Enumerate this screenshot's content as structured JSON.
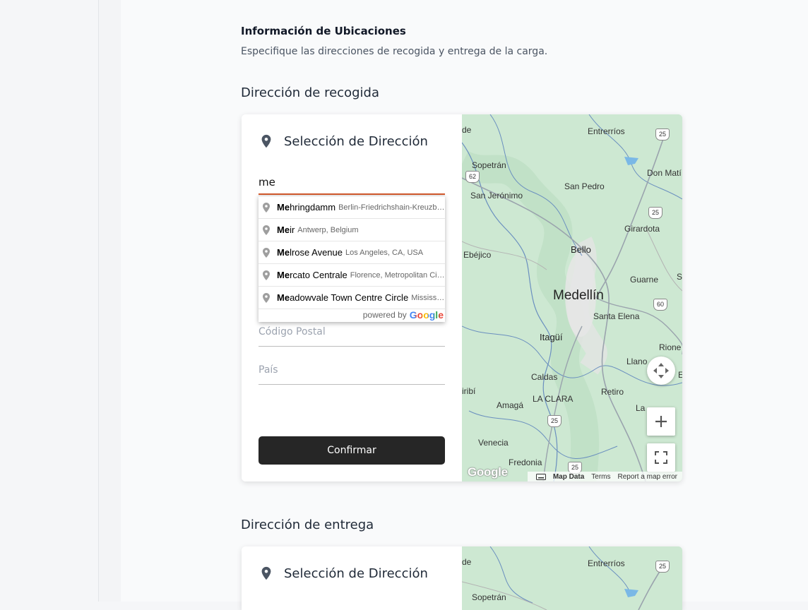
{
  "section": {
    "title": "Información de Ubicaciones",
    "subtitle": "Especifique las direcciones de recogida y entrega de la carga."
  },
  "pickup": {
    "heading": "Dirección de recogida",
    "card_title": "Selección de Dirección",
    "input_value": "me",
    "postal_placeholder": "Código Postal",
    "country_placeholder": "País",
    "confirm_label": "Confirmar"
  },
  "autocomplete": {
    "items": [
      {
        "match": "Me",
        "rest": "hringdamm",
        "secondary": "Berlin-Friedrichshain-Kreuzberg, Berlin, Germany"
      },
      {
        "match": "Me",
        "rest": "ir",
        "secondary": "Antwerp, Belgium"
      },
      {
        "match": "Me",
        "rest": "lrose Avenue",
        "secondary": "Los Angeles, CA, USA"
      },
      {
        "match": "Me",
        "rest": "rcato Centrale",
        "secondary": "Florence, Metropolitan City of Florence, Italy"
      },
      {
        "match": "Me",
        "rest": "adowvale Town Centre Circle",
        "secondary": "Mississauga, ON, Canada"
      }
    ],
    "powered_by": "powered by",
    "brand": "Google"
  },
  "map": {
    "labels": {
      "entrerrios": "Entrerríos",
      "sopetran": "Sopetrán",
      "don_matias": "Don Matí",
      "san_jeronimo": "San Jerónimo",
      "san_pedro": "San Pedro",
      "girardota": "Girardota",
      "ebejico": "Ebéjico",
      "bello": "Bello",
      "guarne": "Guarne",
      "medellin": "Medellín",
      "santa_elena": "Santa Elena",
      "itagui": "Itagüí",
      "rionegro": "Rione",
      "caldas": "Caldas",
      "llano": "Llano",
      "retiro": "Retiro",
      "amaga": "Amagá",
      "la_clara": "LA CLARA",
      "la_ceja": "La",
      "venecia": "Venecia",
      "fredonia": "Fredonia",
      "s_edge": "S",
      "iribi": "iribí",
      "e_edge": "E",
      "de_edge": "de"
    },
    "shields": {
      "r25a": "25",
      "r62": "62",
      "r25b": "25",
      "r60": "60",
      "r25c": "25",
      "r25d": "25"
    },
    "watermark": "Google",
    "footer": {
      "map_data": "Map Data",
      "terms": "Terms",
      "report": "Report a map error"
    }
  },
  "delivery": {
    "heading": "Dirección de entrega",
    "card_title": "Selección de Dirección",
    "map_labels": {
      "entrerrios": "Entrerríos",
      "sopetran": "Sopetrán",
      "de_edge": "de"
    },
    "shield": "25"
  },
  "colors": {
    "input_focus": "#d4582a",
    "button_bg": "#262626",
    "map_green": "#cfe9d4"
  }
}
